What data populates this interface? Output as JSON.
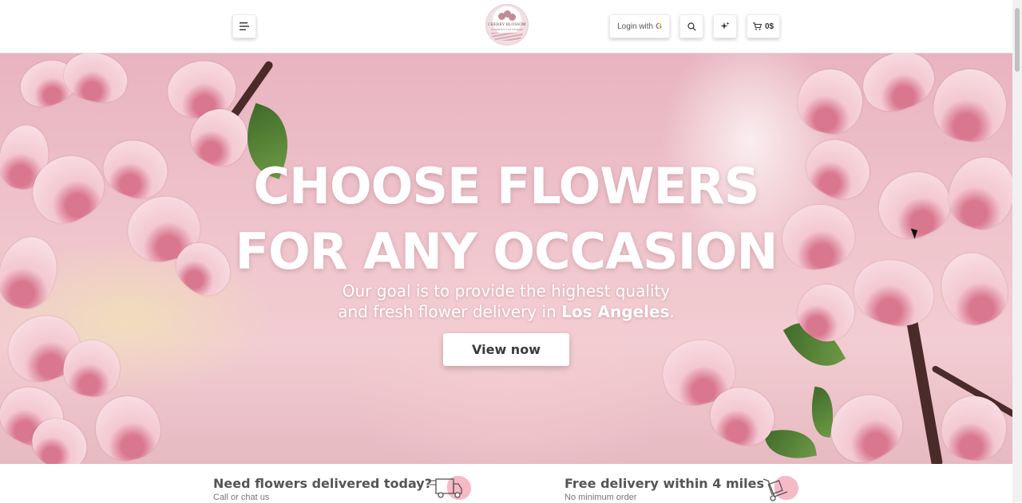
{
  "header": {
    "menu_icon": "hamburger-menu-icon",
    "logo": {
      "name": "CHERRY BLOSSOM",
      "tagline": "FLOWERS IN LOS ANGELES"
    },
    "login_label": "Login with",
    "login_provider_icon": "google-icon",
    "search_icon": "search-icon",
    "sparkle_icon": "sparkle-icon",
    "cart": {
      "icon": "cart-icon",
      "total": "0$"
    }
  },
  "hero": {
    "title_line1": "CHOOSE FLOWERS",
    "title_line2": "FOR ANY OCCASION",
    "subtitle_line1": "Our goal is to provide the highest quality",
    "subtitle_line2_prefix": "and fresh flower delivery in ",
    "subtitle_city": "Los Angeles",
    "subtitle_suffix": ".",
    "cta_label": "View now"
  },
  "features": [
    {
      "title": "Need flowers delivered today?",
      "subtitle": "Call or chat us",
      "icon": "delivery-truck-icon"
    },
    {
      "title": "Free delivery within 4 miles",
      "subtitle": "No minimum order",
      "icon": "hand-truck-icon"
    }
  ],
  "colors": {
    "accent_pink": "#f6b9c6",
    "text_gray": "#555555",
    "hero_text": "#ffffff"
  }
}
